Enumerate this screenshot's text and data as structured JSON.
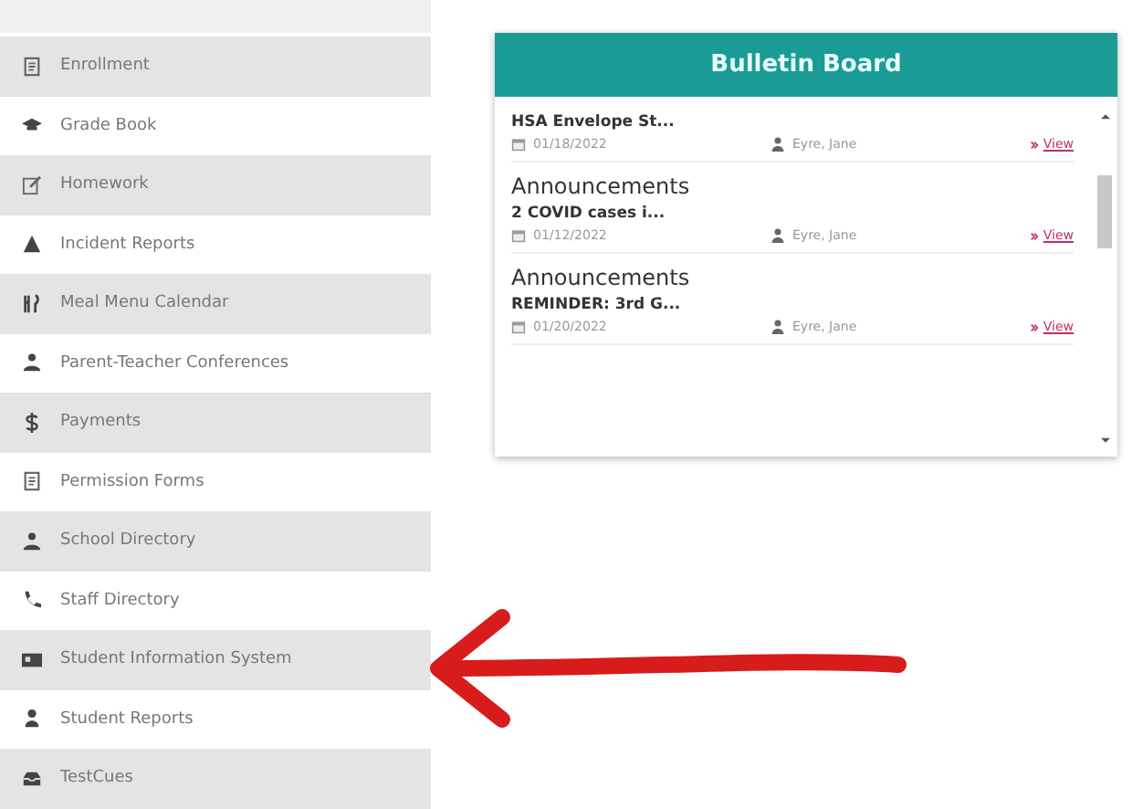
{
  "sidebar": {
    "items": [
      {
        "label": "Enrollment"
      },
      {
        "label": "Grade Book"
      },
      {
        "label": "Homework"
      },
      {
        "label": "Incident Reports"
      },
      {
        "label": "Meal Menu Calendar"
      },
      {
        "label": "Parent-Teacher Conferences"
      },
      {
        "label": "Payments"
      },
      {
        "label": "Permission Forms"
      },
      {
        "label": "School Directory"
      },
      {
        "label": "Staff Directory"
      },
      {
        "label": "Student Information System"
      },
      {
        "label": "Student Reports"
      },
      {
        "label": "TestCues"
      }
    ]
  },
  "bulletin_board": {
    "title": "Bulletin Board",
    "posts": [
      {
        "title": "HSA Envelope St...",
        "date": "01/18/2022",
        "author": "Eyre, Jane",
        "link": "View"
      },
      {
        "category": "Announcements",
        "title": "2 COVID cases i...",
        "date": "01/12/2022",
        "author": "Eyre, Jane",
        "link": "View"
      },
      {
        "category": "Announcements",
        "title": "REMINDER: 3rd G...",
        "date": "01/20/2022",
        "author": "Eyre, Jane",
        "link": "View"
      }
    ]
  }
}
